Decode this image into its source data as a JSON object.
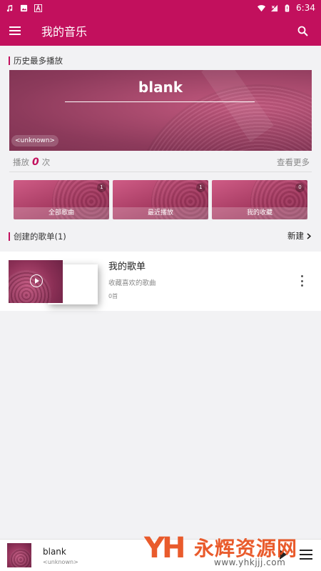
{
  "status_bar": {
    "time": "6:34"
  },
  "app_bar": {
    "title": "我的音乐"
  },
  "history": {
    "header": "历史最多播放",
    "song_title": "blank",
    "artist": "<unknown>",
    "play_prefix": "播放",
    "play_count": "0",
    "play_suffix": "次",
    "more_label": "查看更多"
  },
  "quick_cards": [
    {
      "label": "全部歌曲",
      "count": "1"
    },
    {
      "label": "最近播放",
      "count": "1"
    },
    {
      "label": "我的收藏",
      "count": "0"
    }
  ],
  "playlists": {
    "header": "创建的歌单(1)",
    "new_label": "新建",
    "items": [
      {
        "name": "我的歌单",
        "description": "收藏喜欢的歌曲",
        "count": "0首"
      }
    ]
  },
  "player": {
    "song": "blank",
    "artist": "<unknown>"
  },
  "watermark": {
    "logo_text": "YH",
    "site_name": "永辉资源网",
    "url": "www.yhkjjj.com"
  },
  "colors": {
    "accent": "#c2105d",
    "background": "#f2f2f4"
  }
}
